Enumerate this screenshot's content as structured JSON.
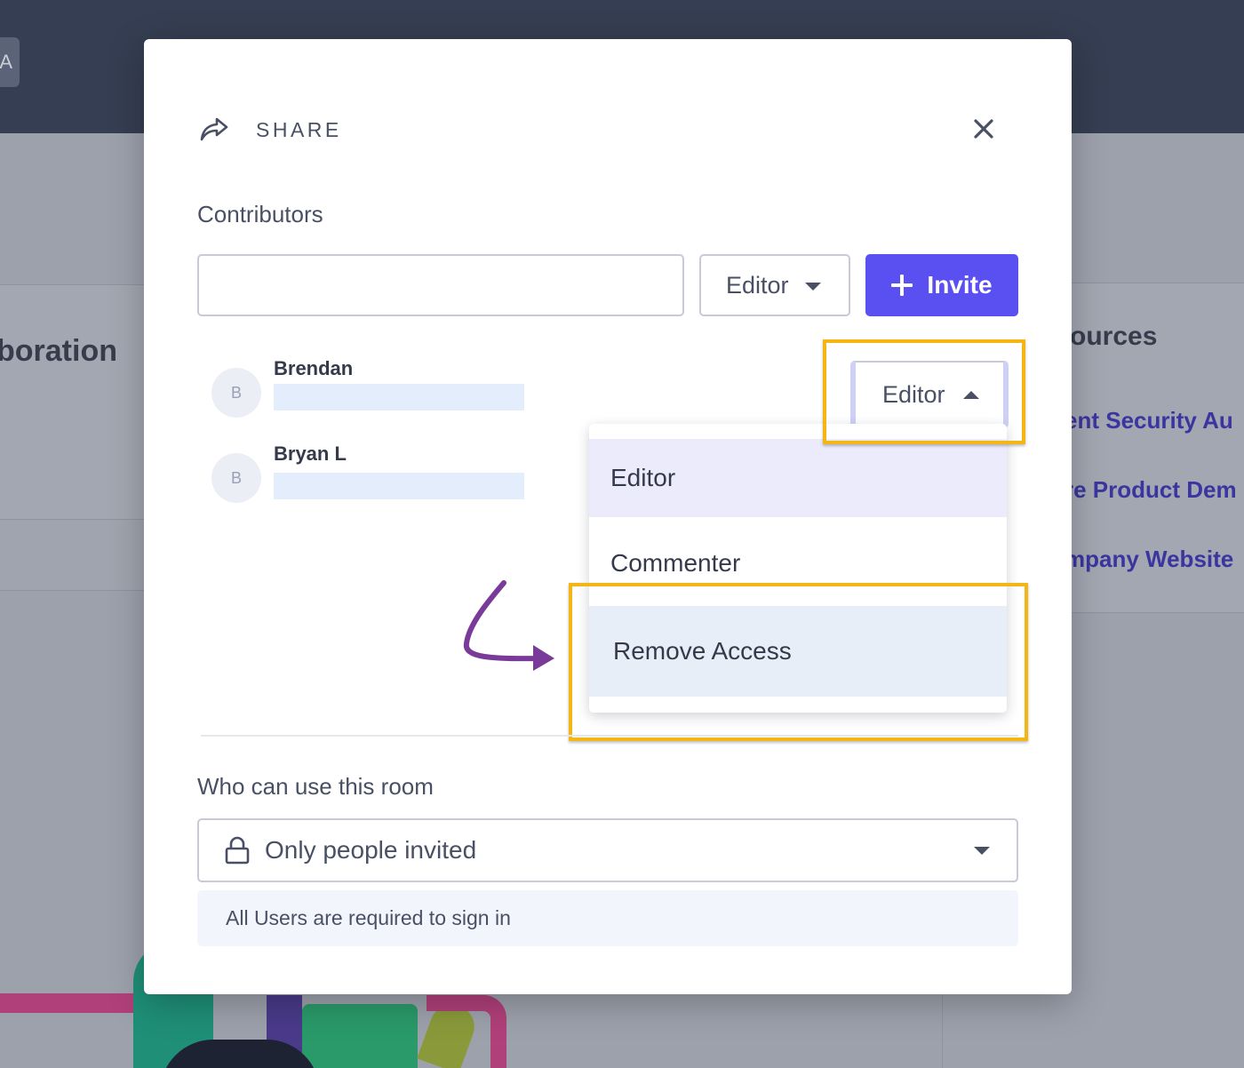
{
  "background": {
    "avatar_letter": "A",
    "left_title": "boration",
    "right_title": "ources",
    "right_links": [
      "ent Security Au",
      "re Product Dem",
      "mpany Website"
    ]
  },
  "modal": {
    "title": "SHARE",
    "contributors_label": "Contributors",
    "invite_input": {
      "value": "",
      "placeholder": ""
    },
    "role_select": "Editor",
    "invite_button": "Invite",
    "contributors": [
      {
        "initial": "B",
        "name": "Brendan"
      },
      {
        "initial": "B",
        "name": "Bryan L"
      }
    ],
    "row_role": "Editor",
    "dropdown": {
      "options": [
        "Editor",
        "Commenter",
        "Remove Access"
      ],
      "selected": "Editor"
    },
    "room_label": "Who can use this room",
    "room_select": "Only people invited",
    "room_note": "All Users are required to sign in"
  },
  "colors": {
    "accent": "#5a4ff0",
    "highlight": "#f2b617",
    "annotation_arrow": "#7a3a9a"
  },
  "icons": [
    "share-icon",
    "close-icon",
    "plus-icon",
    "caret-down-icon",
    "caret-up-icon",
    "lock-icon",
    "annotation-arrow"
  ]
}
